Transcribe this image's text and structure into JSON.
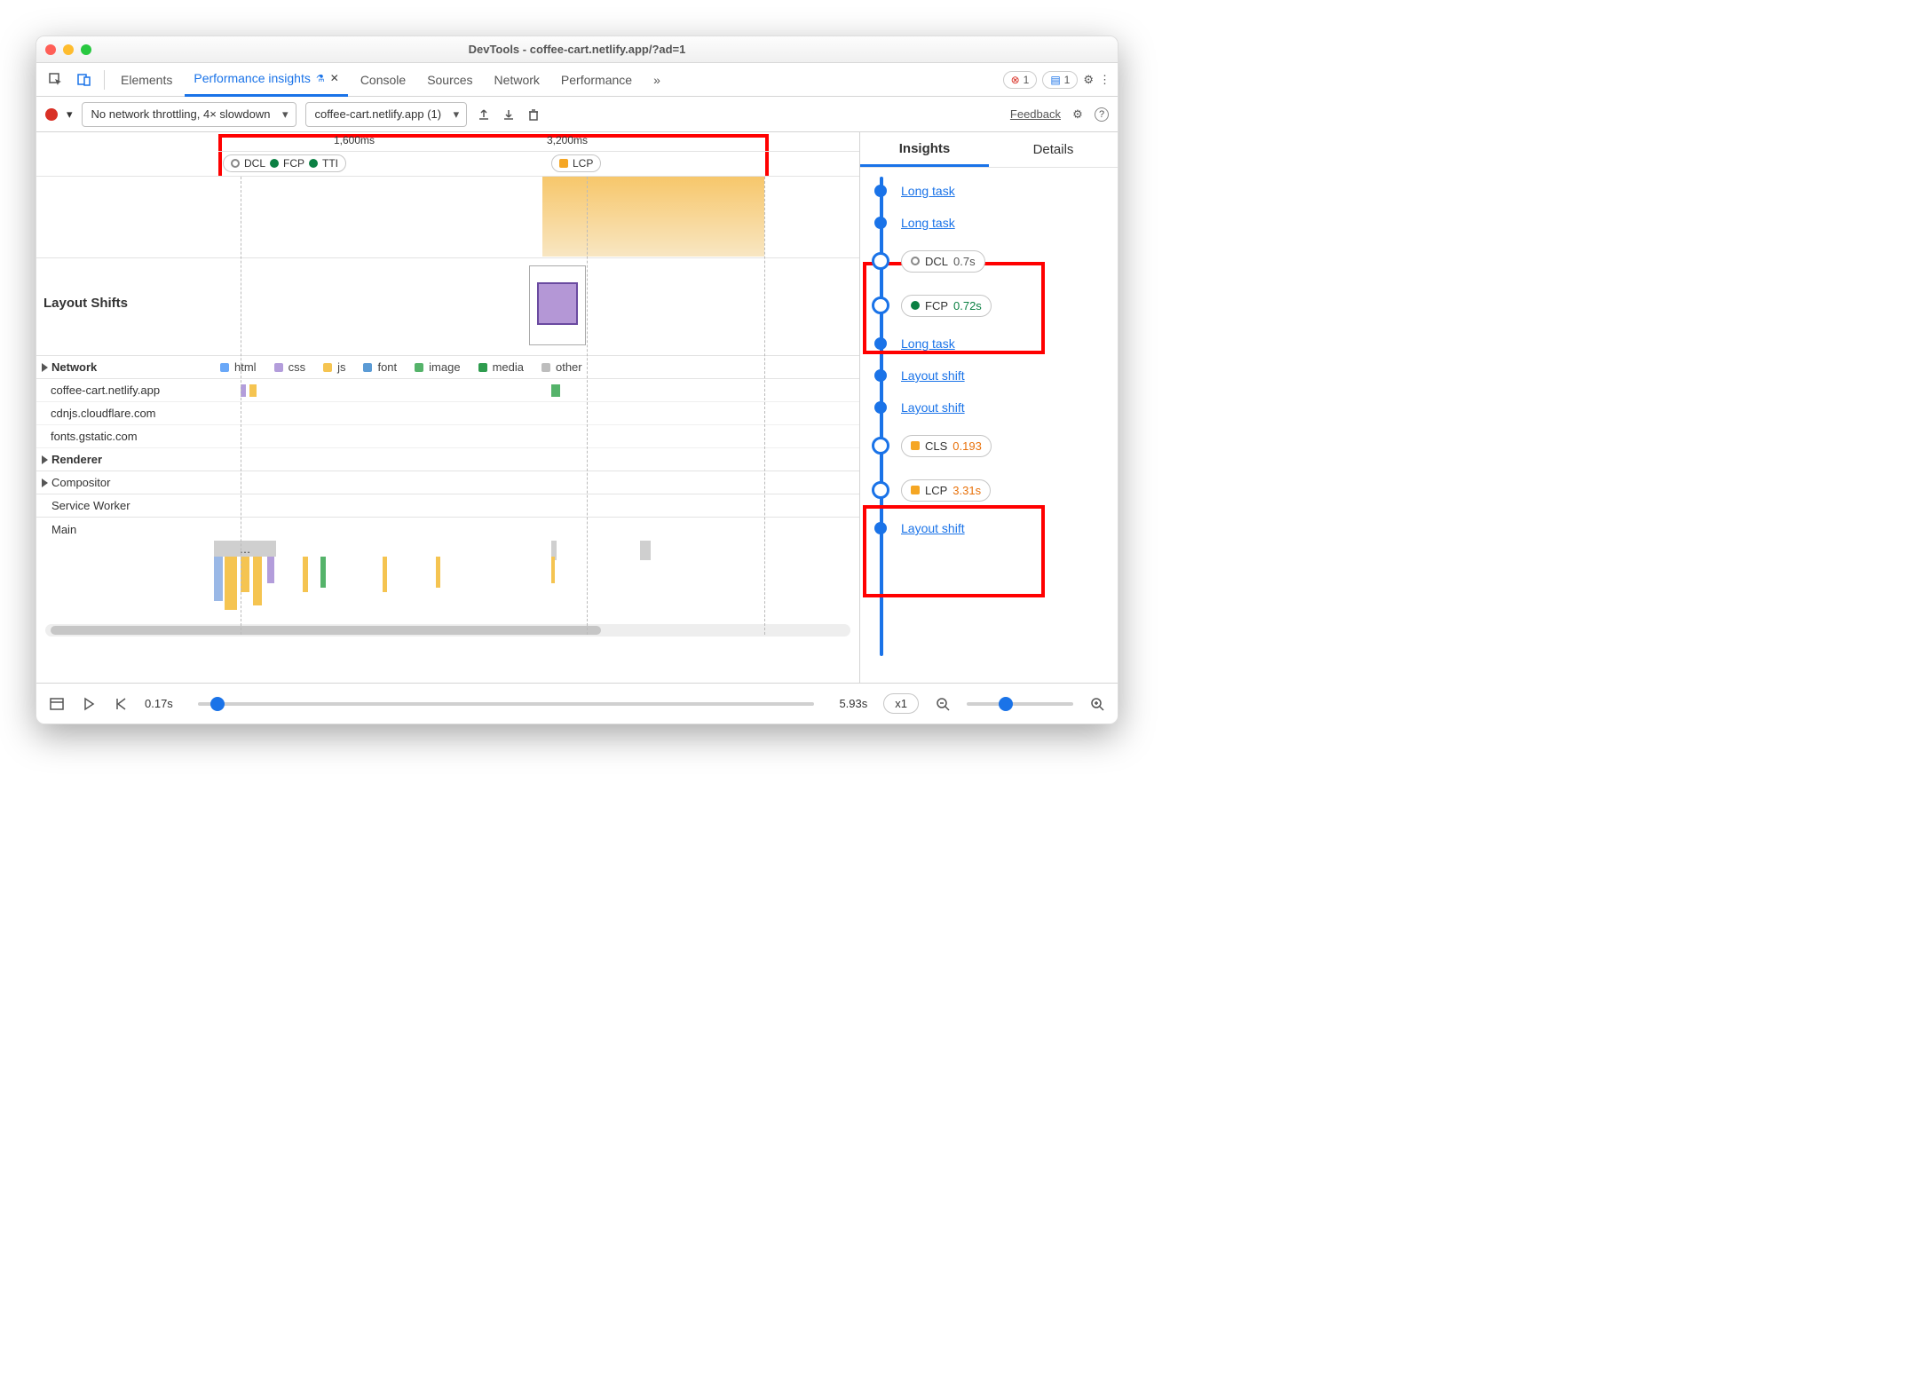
{
  "window": {
    "title": "DevTools - coffee-cart.netlify.app/?ad=1"
  },
  "tabs": {
    "items": [
      "Elements",
      "Performance insights",
      "Console",
      "Sources",
      "Network",
      "Performance"
    ],
    "active_index": 1,
    "overflow": "»",
    "errors": "1",
    "messages": "1"
  },
  "toolbar": {
    "throttle": "No network throttling, 4× slowdown",
    "target": "coffee-cart.netlify.app (1)",
    "feedback": "Feedback"
  },
  "ruler": {
    "t1": "1,600ms",
    "t2": "3,200ms"
  },
  "markers": {
    "group1": {
      "dcl": "DCL",
      "fcp": "FCP",
      "tti": "TTI"
    },
    "group2": {
      "lcp": "LCP"
    }
  },
  "sections": {
    "layout_shifts": "Layout Shifts",
    "network": "Network",
    "renderer": "Renderer",
    "compositor": "Compositor",
    "service_worker": "Service Worker",
    "main": "Main"
  },
  "legend": {
    "html": "html",
    "css": "css",
    "js": "js",
    "font": "font",
    "image": "image",
    "media": "media",
    "other": "other"
  },
  "hosts": [
    "coffee-cart.netlify.app",
    "cdnjs.cloudflare.com",
    "fonts.gstatic.com"
  ],
  "insights": {
    "tabs": {
      "insights": "Insights",
      "details": "Details"
    },
    "rows": [
      {
        "type": "link",
        "label": "Long task"
      },
      {
        "type": "link",
        "label": "Long task"
      },
      {
        "type": "chip",
        "marker": "ring",
        "name": "DCL",
        "value": "0.7s",
        "cls": ""
      },
      {
        "type": "chip",
        "marker": "green",
        "name": "FCP",
        "value": "0.72s",
        "cls": ""
      },
      {
        "type": "link",
        "label": "Long task"
      },
      {
        "type": "link",
        "label": "Layout shift"
      },
      {
        "type": "link",
        "label": "Layout shift"
      },
      {
        "type": "chip",
        "marker": "orange",
        "name": "CLS",
        "value": "0.193",
        "cls": "orng"
      },
      {
        "type": "chip",
        "marker": "orange",
        "name": "LCP",
        "value": "3.31s",
        "cls": "orng"
      },
      {
        "type": "link",
        "label": "Layout shift"
      }
    ]
  },
  "footer": {
    "start": "0.17s",
    "end": "5.93s",
    "speed": "x1"
  }
}
